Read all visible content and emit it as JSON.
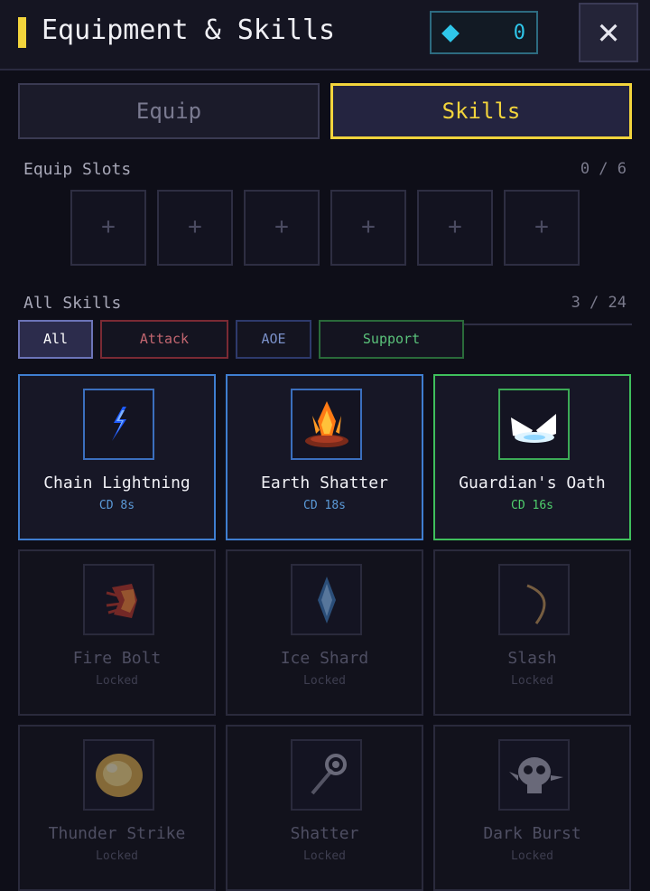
{
  "header": {
    "title": "Equipment & Skills",
    "gems": "0",
    "close_label": "✕"
  },
  "tabs": [
    {
      "label": "Equip",
      "active": false
    },
    {
      "label": "Skills",
      "active": true
    }
  ],
  "equip_slots": {
    "label": "Equip Slots",
    "count": "0 / 6",
    "slots": [
      "+",
      "+",
      "+",
      "+",
      "+",
      "+"
    ]
  },
  "all_skills": {
    "label": "All Skills",
    "count": "3 / 24",
    "filters": [
      {
        "label": "All",
        "active": true
      },
      {
        "label": "Attack",
        "active": false
      },
      {
        "label": "AOE",
        "active": false
      },
      {
        "label": "Support",
        "active": false
      }
    ]
  },
  "skills": [
    {
      "name": "Chain Lightning",
      "sub": "CD 8s",
      "icon": "lightning-icon",
      "state": "unlocked"
    },
    {
      "name": "Earth Shatter",
      "sub": "CD 18s",
      "icon": "campfire-icon",
      "state": "unlocked"
    },
    {
      "name": "Guardian's Oath",
      "sub": "CD 16s",
      "icon": "wings-icon",
      "state": "unlocked"
    },
    {
      "name": "Fire Bolt",
      "sub": "Locked",
      "icon": "fire-burst-icon",
      "state": "locked"
    },
    {
      "name": "Ice Shard",
      "sub": "Locked",
      "icon": "ice-crystal-icon",
      "state": "locked"
    },
    {
      "name": "Slash",
      "sub": "Locked",
      "icon": "slash-arc-icon",
      "state": "locked"
    },
    {
      "name": "Thunder Strike",
      "sub": "Locked",
      "icon": "thunder-orb-icon",
      "state": "locked"
    },
    {
      "name": "Shatter",
      "sub": "Locked",
      "icon": "mace-icon",
      "state": "locked"
    },
    {
      "name": "Dark Burst",
      "sub": "Locked",
      "icon": "skull-icon",
      "state": "locked"
    }
  ],
  "colors": {
    "accent": "#f2d43c",
    "gem": "#2fc7ea",
    "attack": "#c26670",
    "aoe": "#7a90c8",
    "support": "#5ac27a",
    "card_blue": "#3f7ed0",
    "card_green": "#3fbf5c"
  }
}
